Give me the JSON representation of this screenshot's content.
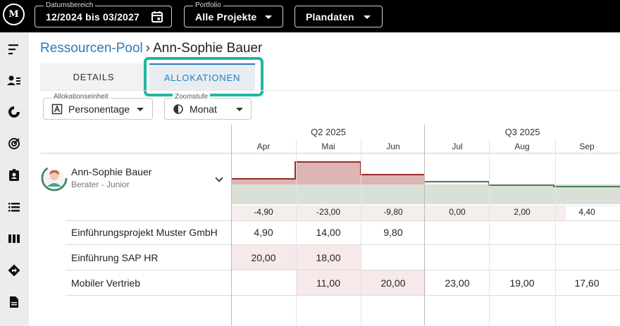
{
  "topbar": {
    "logo_text": "M",
    "date_range": {
      "legend": "Datumsbereich",
      "value": "12/2024 bis 03/2027"
    },
    "portfolio": {
      "legend": "Portfolio",
      "value": "Alle Projekte"
    },
    "plandata": {
      "value": "Plandaten"
    }
  },
  "sidebar": {
    "icons": [
      "menu-collapse-icon",
      "people-list-icon",
      "donut-chart-icon",
      "target-icon",
      "id-badge-icon",
      "list-icon",
      "columns-icon",
      "directions-icon",
      "document-icon"
    ]
  },
  "breadcrumb": {
    "parent": "Ressourcen-Pool",
    "separator": "›",
    "current": "Ann-Sophie Bauer"
  },
  "tabs": [
    {
      "label": "DETAILS",
      "active": false
    },
    {
      "label": "ALLOKATIONEN",
      "active": true
    }
  ],
  "filters": {
    "unit": {
      "legend": "Allokationseinheit",
      "value": "Personentage",
      "icon": "calendar-a-icon"
    },
    "zoom": {
      "legend": "Zoomstufe",
      "value": "Monat",
      "icon": "half-circle-icon"
    }
  },
  "timeline": {
    "quarters": [
      "Q2 2025",
      "Q3 2025"
    ],
    "months": [
      "Apr",
      "Mai",
      "Jun",
      "Jul",
      "Aug",
      "Sep"
    ]
  },
  "resource": {
    "name": "Ann-Sophie Bauer",
    "role": "Berater - Junior",
    "capacity_delta": [
      "-4,90",
      "-23,00",
      "-9,80",
      "0,00",
      "2,00",
      "4,40"
    ]
  },
  "projects": [
    {
      "name": "Einführungsprojekt Muster GmbH",
      "values": [
        "4,90",
        "14,00",
        "9,80",
        "",
        "",
        ""
      ]
    },
    {
      "name": "Einführung SAP HR",
      "values": [
        "20,00",
        "18,00",
        "",
        "",
        "",
        ""
      ]
    },
    {
      "name": "Mobiler Vertrieb",
      "values": [
        "",
        "11,00",
        "20,00",
        "23,00",
        "19,00",
        "17,60"
      ]
    }
  ],
  "colors": {
    "accent": "#2b7bb9",
    "highlight": "#1fb7a5",
    "over": "#9e2a2a",
    "under": "#4f7a5c"
  }
}
